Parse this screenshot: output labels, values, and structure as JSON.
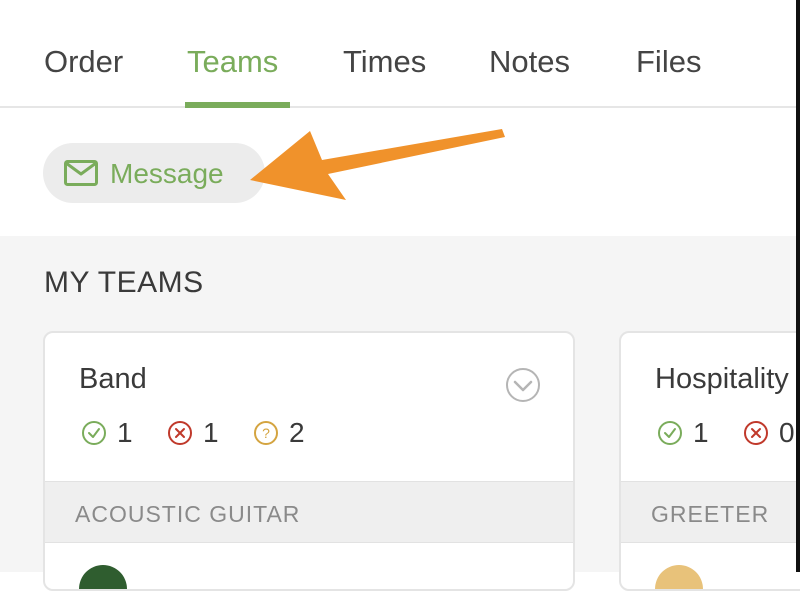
{
  "tabs": [
    {
      "label": "Order",
      "active": false
    },
    {
      "label": "Teams",
      "active": true
    },
    {
      "label": "Times",
      "active": false
    },
    {
      "label": "Notes",
      "active": false
    },
    {
      "label": "Files",
      "active": false
    }
  ],
  "message_button": {
    "label": "Message",
    "icon": "envelope-icon"
  },
  "section": {
    "title": "MY TEAMS"
  },
  "teams": [
    {
      "name": "Band",
      "confirmed": "1",
      "declined": "1",
      "pending": "2",
      "position": "ACOUSTIC GUITAR"
    },
    {
      "name": "Hospitality",
      "confirmed": "1",
      "declined": "0",
      "position": "GREETER"
    }
  ],
  "colors": {
    "accent": "#7aac5b",
    "declined": "#c0392b",
    "pending": "#d4a440",
    "annotation_arrow": "#f0922b"
  }
}
